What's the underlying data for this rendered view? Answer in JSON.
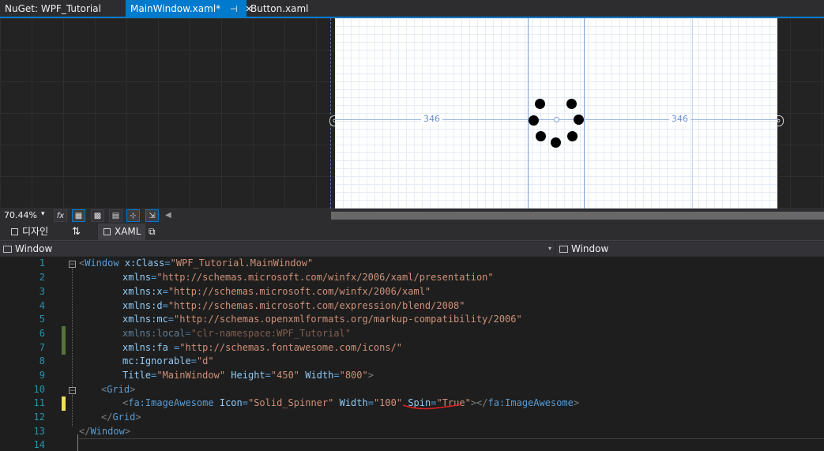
{
  "tabs": [
    {
      "label": "NuGet: WPF_Tutorial",
      "active": false
    },
    {
      "label": "MainWindow.xaml*",
      "active": true,
      "pin_glyph": "⊣",
      "close_glyph": "✕"
    },
    {
      "label": "Button.xaml",
      "active": false
    }
  ],
  "designer": {
    "dimension_left": "346",
    "dimension_right": "346",
    "anchor_glyph": "∞",
    "spinner_icon": "spinner-icon"
  },
  "zoom": {
    "value": "70.44%",
    "dropdown_glyph": "▾",
    "buttons": [
      {
        "name": "formula-button",
        "glyph": "fx"
      },
      {
        "name": "grid-toggle-button",
        "glyph": "▦"
      },
      {
        "name": "artboard-background-button",
        "glyph": "▩"
      },
      {
        "name": "checkerboard-button",
        "glyph": "▤"
      },
      {
        "name": "snap-to-gridlines-button",
        "glyph": "⊹"
      },
      {
        "name": "snap-to-snaplines-button",
        "glyph": "⇲"
      }
    ],
    "scroll_left_glyph": "◀"
  },
  "split": {
    "design_label": "디자인",
    "swap_glyph": "⇅",
    "xaml_label": "XAML",
    "popout_glyph": "⧉"
  },
  "nav": {
    "left_combo": "Window",
    "right_combo": "Window",
    "dropdown_glyph": "▾"
  },
  "colors": {
    "accent": "#007acc",
    "line_number": "#2b91af",
    "xml_element": "#569cd6",
    "xml_attribute": "#92caf4",
    "xml_value": "#ce9178",
    "changed_saved": "#57733a",
    "changed_unsaved": "#f1e05a",
    "squiggle": "#e02020"
  },
  "editor": {
    "line_numbers": [
      "1",
      "2",
      "3",
      "4",
      "5",
      "6",
      "7",
      "8",
      "9",
      "10",
      "11",
      "12",
      "13",
      "14"
    ],
    "lines": {
      "l1": {
        "lt": "<",
        "el": "Window",
        "sp": " ",
        "a1": "x:Class",
        "eq1": "=",
        "v1": "\"WPF_Tutorial.MainWindow\""
      },
      "l2": {
        "a": "xmlns",
        "eq": "=",
        "v": "\"http://schemas.microsoft.com/winfx/2006/xaml/presentation\""
      },
      "l3": {
        "a": "xmlns:x",
        "eq": "=",
        "v": "\"http://schemas.microsoft.com/winfx/2006/xaml\""
      },
      "l4": {
        "a": "xmlns:d",
        "eq": "=",
        "v": "\"http://schemas.microsoft.com/expression/blend/2008\""
      },
      "l5": {
        "a": "xmlns:mc",
        "eq": "=",
        "v": "\"http://schemas.openxmlformats.org/markup-compatibility/2006\""
      },
      "l6": {
        "a": "xmlns:local",
        "eq": "=",
        "v": "\"clr-namespace:WPF_Tutorial\""
      },
      "l7": {
        "a": "xmlns:fa ",
        "eq": "=",
        "v": "\"http://schemas.fontawesome.com/icons/\""
      },
      "l8": {
        "a": "mc:Ignorable",
        "eq": "=",
        "v": "\"d\""
      },
      "l9": {
        "a1": "Title",
        "eq1": "=",
        "v1": "\"MainWindow\"",
        "a2": "Height",
        "eq2": "=",
        "v2": "\"450\"",
        "a3": "Width",
        "eq3": "=",
        "v3": "\"800\"",
        "gt": ">"
      },
      "l10": {
        "lt": "<",
        "el": "Grid",
        "gt": ">"
      },
      "l11": {
        "lt": "<",
        "el": "fa:ImageAwesome",
        "a1": "Icon",
        "eq1": "=",
        "v1": "\"Solid_Spinner\"",
        "a2": "Width",
        "eq2": "=",
        "v2": "\"100\"",
        "a3": "Spin",
        "eq3": "=",
        "v3": "\"True\"",
        "gt": ">",
        "close_lt": "</",
        "close_el": "fa:ImageAwesome",
        "close_gt": ">"
      },
      "l12": {
        "lt": "</",
        "el": "Grid",
        "gt": ">"
      },
      "l13": {
        "lt": "</",
        "el": "Window",
        "gt": ">"
      }
    }
  }
}
